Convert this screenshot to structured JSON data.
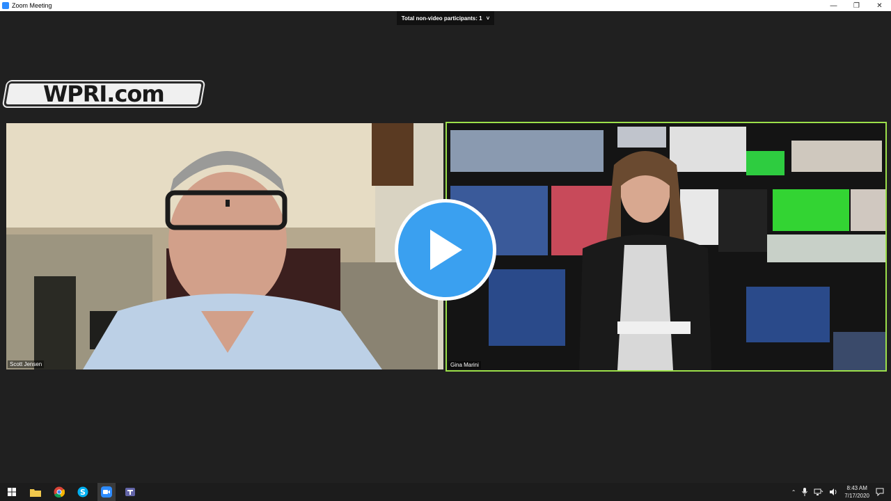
{
  "window": {
    "title": "Zoom Meeting"
  },
  "meeting": {
    "participants_label": "Total non-video participants: 1",
    "chevron": "˅"
  },
  "logo": {
    "text": "WPRI.com"
  },
  "participants": [
    {
      "name": "Scott Jensen"
    },
    {
      "name": "Gina Marini"
    }
  ],
  "taskbar": {
    "apps": [
      "windows-start-icon",
      "file-explorer-icon",
      "chrome-icon",
      "skype-icon",
      "zoom-icon",
      "teams-icon"
    ],
    "time": "8:43 AM",
    "date": "7/17/2020"
  },
  "colors": {
    "active_speaker_border": "#9ce04a",
    "play_button": "#3aa0f0",
    "zoom_blue": "#2d8cff"
  }
}
